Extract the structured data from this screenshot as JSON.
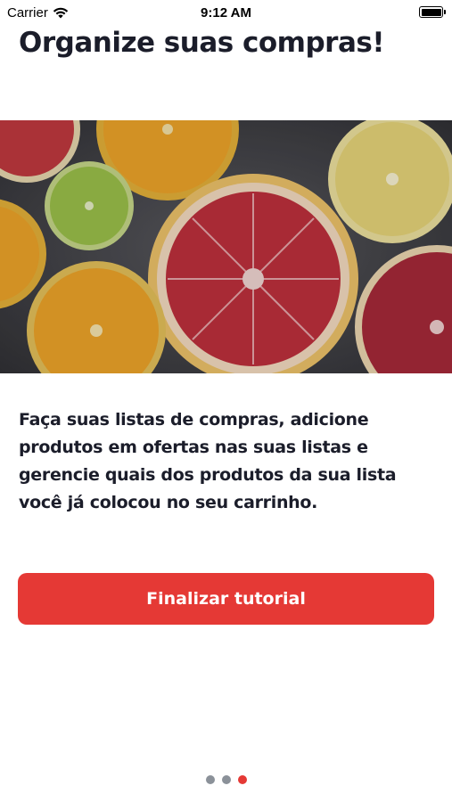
{
  "status_bar": {
    "carrier": "Carrier",
    "time": "9:12 AM"
  },
  "onboarding": {
    "title": "Organize suas compras!",
    "image_alt": "citrus fruit slices",
    "description": "Faça suas listas de compras, adicione produtos em ofertas nas suas listas e gerencie quais dos produtos da sua lista você já colocou no seu carrinho.",
    "cta_label": "Finalizar tutorial"
  },
  "pagination": {
    "total": 3,
    "active_index": 2
  },
  "colors": {
    "accent": "#e53935",
    "text": "#1b1d2a",
    "dot_inactive": "#8b9199"
  }
}
